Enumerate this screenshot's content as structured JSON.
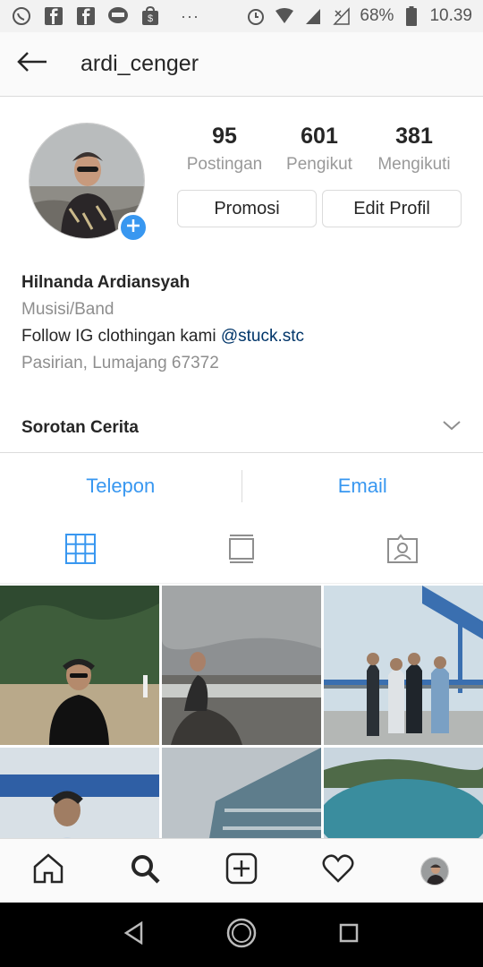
{
  "status_bar": {
    "battery": "68%",
    "time": "10.39",
    "overflow": "···"
  },
  "header": {
    "username": "ardi_cenger"
  },
  "profile": {
    "stats": [
      {
        "value": "95",
        "label": "Postingan"
      },
      {
        "value": "601",
        "label": "Pengikut"
      },
      {
        "value": "381",
        "label": "Mengikuti"
      }
    ],
    "promote_label": "Promosi",
    "edit_label": "Edit Profil"
  },
  "bio": {
    "name": "Hilnanda Ardiansyah",
    "category": "Musisi/Band",
    "text": "Follow IG clothingan kami ",
    "mention": "@stuck.stc",
    "location": "Pasirian, Lumajang 67372"
  },
  "highlights": {
    "label": "Sorotan Cerita"
  },
  "contact": {
    "call_label": "Telepon",
    "email_label": "Email"
  },
  "colors": {
    "accent": "#3897f0",
    "mention": "#003569",
    "muted": "#8e8e8e",
    "border": "#dbdbdb"
  },
  "icons": {
    "back": "arrow-left-icon",
    "tab_grid": "grid-icon",
    "tab_feed": "feed-icon",
    "tab_tagged": "tagged-icon",
    "nav_home": "home-icon",
    "nav_search": "search-icon",
    "nav_add": "add-post-icon",
    "nav_activity": "heart-icon",
    "android_back": "triangle-back-icon",
    "android_home": "circle-home-icon",
    "android_recent": "square-recents-icon"
  }
}
